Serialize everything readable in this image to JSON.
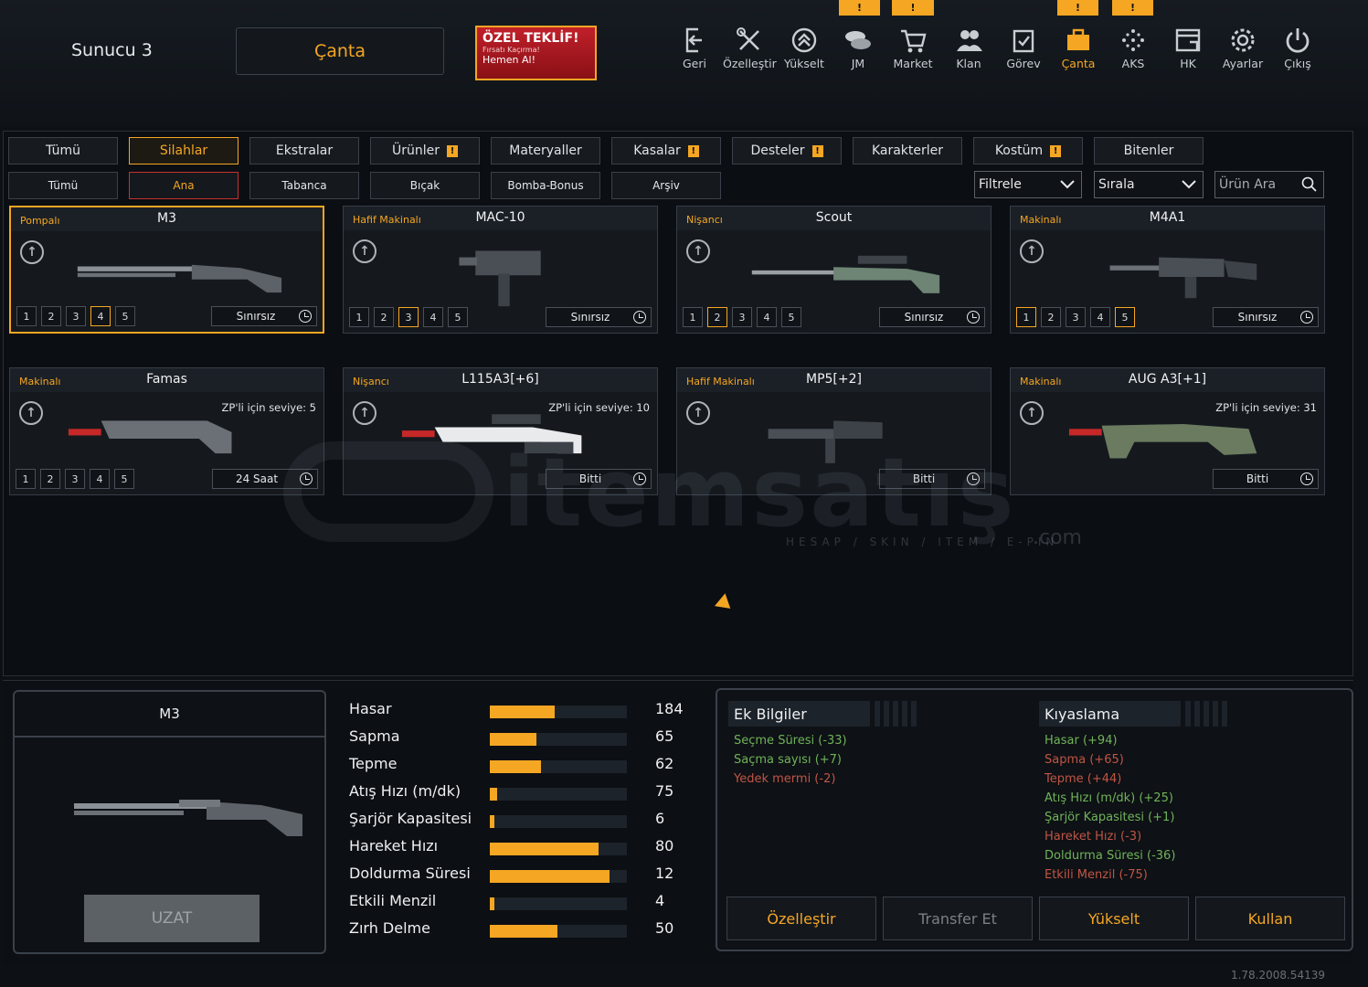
{
  "header": {
    "server": "Sunucu 3",
    "bag_button": "Çanta",
    "offer": {
      "title": "ÖZEL TEKLİF!",
      "subtitle": "Fırsatı Kaçırma!",
      "cta": "Hemen Al!"
    },
    "nav": [
      {
        "label": "Geri",
        "icon": "back-icon"
      },
      {
        "label": "Özelleştir",
        "icon": "tools-icon"
      },
      {
        "label": "Yükselt",
        "icon": "upgrade-icon"
      },
      {
        "label": "JM",
        "icon": "coins-icon",
        "badge": "!"
      },
      {
        "label": "Market",
        "icon": "cart-icon",
        "badge": "!"
      },
      {
        "label": "Klan",
        "icon": "clan-icon"
      },
      {
        "label": "Görev",
        "icon": "mission-icon"
      },
      {
        "label": "Çanta",
        "icon": "bag-icon",
        "badge": "!",
        "active": true
      },
      {
        "label": "AKS",
        "icon": "aks-icon",
        "badge": "!"
      },
      {
        "label": "HK",
        "icon": "hk-icon"
      },
      {
        "label": "Ayarlar",
        "icon": "gear-icon"
      },
      {
        "label": "Çıkış",
        "icon": "power-icon"
      }
    ]
  },
  "tabs": [
    {
      "label": "Tümü"
    },
    {
      "label": "Silahlar",
      "selected": true
    },
    {
      "label": "Ekstralar"
    },
    {
      "label": "Ürünler",
      "warn": true
    },
    {
      "label": "Materyaller"
    },
    {
      "label": "Kasalar",
      "warn": true
    },
    {
      "label": "Desteler",
      "warn": true
    },
    {
      "label": "Karakterler"
    },
    {
      "label": "Kostüm",
      "warn": true
    },
    {
      "label": "Bitenler"
    }
  ],
  "subtabs": [
    {
      "label": "Tümü"
    },
    {
      "label": "Ana",
      "selected": true
    },
    {
      "label": "Tabanca"
    },
    {
      "label": "Bıçak"
    },
    {
      "label": "Bomba-Bonus"
    },
    {
      "label": "Arşiv"
    }
  ],
  "filter": "Filtrele",
  "sort": "Sırala",
  "search_placeholder": "Ürün Ara",
  "cards": [
    {
      "category": "Pompalı",
      "name": "M3",
      "levels": [
        "1",
        "2",
        "3",
        "4",
        "5"
      ],
      "active_levels": [
        4
      ],
      "duration": "Sınırsız",
      "selected": true
    },
    {
      "category": "Hafif Makinalı",
      "name": "MAC-10",
      "levels": [
        "1",
        "2",
        "3",
        "4",
        "5"
      ],
      "active_levels": [
        3
      ],
      "duration": "Sınırsız"
    },
    {
      "category": "Nişancı",
      "name": "Scout",
      "levels": [
        "1",
        "2",
        "3",
        "4",
        "5"
      ],
      "active_levels": [
        2
      ],
      "duration": "Sınırsız"
    },
    {
      "category": "Makinalı",
      "name": "M4A1",
      "levels": [
        "1",
        "2",
        "3",
        "4",
        "5"
      ],
      "active_levels": [
        1,
        5
      ],
      "duration": "Sınırsız"
    },
    {
      "category": "Makinalı",
      "name": "Famas",
      "levels": [
        "1",
        "2",
        "3",
        "4",
        "5"
      ],
      "active_levels": [],
      "duration": "24 Saat",
      "zp": "ZP'li için seviye: 5"
    },
    {
      "category": "Nişancı",
      "name": "L115A3[+6]",
      "levels": [],
      "active_levels": [],
      "duration": "Bitti",
      "zp": "ZP'li için seviye: 10"
    },
    {
      "category": "Hafif Makinalı",
      "name": "MP5[+2]",
      "levels": [],
      "active_levels": [],
      "duration": "Bitti"
    },
    {
      "category": "Makinalı",
      "name": "AUG A3[+1]",
      "levels": [],
      "active_levels": [],
      "duration": "Bitti",
      "zp": "ZP'li için seviye: 31"
    }
  ],
  "watermark": {
    "text": "itemsatış",
    "sub": "HESAP / SKIN / ITEM / E-PIN",
    "com": ".com"
  },
  "preview": {
    "name": "M3",
    "button": "UZAT"
  },
  "stats": [
    {
      "label": "Hasar",
      "value": "184",
      "pct": 0.47
    },
    {
      "label": "Sapma",
      "value": "65",
      "pct": 0.34
    },
    {
      "label": "Tepme",
      "value": "62",
      "pct": 0.37
    },
    {
      "label": "Atış Hızı (m/dk)",
      "value": "75",
      "pct": 0.05
    },
    {
      "label": "Şarjör Kapasitesi",
      "value": "6",
      "pct": 0.03
    },
    {
      "label": "Hareket Hızı",
      "value": "80",
      "pct": 0.79
    },
    {
      "label": "Doldurma Süresi",
      "value": "12",
      "pct": 0.87
    },
    {
      "label": "Etkili Menzil",
      "value": "4",
      "pct": 0.03
    },
    {
      "label": "Zırh Delme",
      "value": "50",
      "pct": 0.49
    }
  ],
  "extra": {
    "title": "Ek Bilgiler",
    "items": [
      {
        "text": "Seçme Süresi (-33)",
        "color": "green"
      },
      {
        "text": "Saçma sayısı (+7)",
        "color": "green"
      },
      {
        "text": "Yedek mermi (-2)",
        "color": "red"
      }
    ]
  },
  "compare": {
    "title": "Kıyaslama",
    "items": [
      {
        "text": "Hasar (+94)",
        "color": "green"
      },
      {
        "text": "Sapma (+65)",
        "color": "red"
      },
      {
        "text": "Tepme (+44)",
        "color": "red"
      },
      {
        "text": "Atış Hızı (m/dk) (+25)",
        "color": "green"
      },
      {
        "text": "Şarjör Kapasitesi (+1)",
        "color": "green"
      },
      {
        "text": "Hareket Hızı (-3)",
        "color": "red"
      },
      {
        "text": "Doldurma Süresi (-36)",
        "color": "green"
      },
      {
        "text": "Etkili Menzil (-75)",
        "color": "red"
      }
    ]
  },
  "actions": [
    {
      "label": "Özelleştir"
    },
    {
      "label": "Transfer Et",
      "disabled": true
    },
    {
      "label": "Yükselt"
    },
    {
      "label": "Kullan"
    }
  ],
  "version": "1.78.2008.54139",
  "colors": {
    "accent": "#f5a623",
    "green": "#6fb35a",
    "red": "#c05545"
  }
}
